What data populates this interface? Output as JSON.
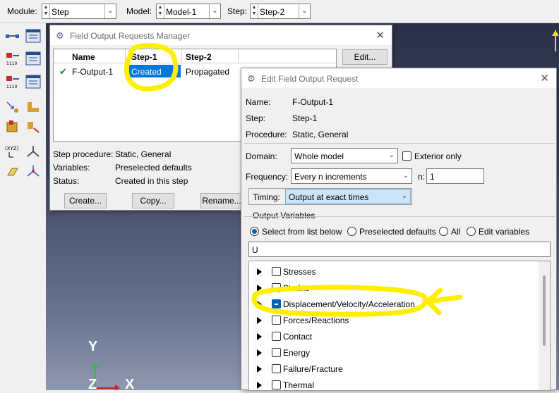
{
  "toolbar": {
    "module_label": "Module:",
    "module_value": "Step",
    "model_label": "Model:",
    "model_value": "Model-1",
    "step_label": "Step:",
    "step_value": "Step-2"
  },
  "canvas": {
    "axis_y": "Y",
    "axis_z": "Z",
    "axis_x": "X"
  },
  "manager": {
    "title": "Field Output Requests Manager",
    "columns": [
      "Name",
      "Step-1",
      "Step-2"
    ],
    "row": {
      "check": "✔",
      "name": "F-Output-1",
      "step1": "Created",
      "step2": "Propagated"
    },
    "edit_button": "Edit...",
    "info": [
      {
        "label": "Step procedure:",
        "value": "Static, General"
      },
      {
        "label": "Variables:",
        "value": "Preselected defaults"
      },
      {
        "label": "Status:",
        "value": "Created in this step"
      }
    ],
    "buttons": {
      "create": "Create...",
      "copy": "Copy...",
      "rename": "Rename..."
    }
  },
  "editor": {
    "title": "Edit Field Output Request",
    "name_label": "Name:",
    "name_value": "F-Output-1",
    "step_label": "Step:",
    "step_value": "Step-1",
    "procedure_label": "Procedure:",
    "procedure_value": "Static, General",
    "domain_label": "Domain:",
    "domain_value": "Whole model",
    "exterior_label": "Exterior only",
    "frequency_label": "Frequency:",
    "frequency_value": "Every n increments",
    "n_label": "n:",
    "n_value": "1",
    "timing_label": "Timing:",
    "timing_value": "Output at exact times",
    "output_vars_label": "Output Variables",
    "radio_options": [
      "Select from list below",
      "Preselected defaults",
      "All",
      "Edit variables"
    ],
    "filter_value": "U",
    "variables": [
      "Stresses",
      "Strains",
      "Displacement/Velocity/Acceleration",
      "Forces/Reactions",
      "Contact",
      "Energy",
      "Failure/Fracture",
      "Thermal"
    ]
  },
  "colors": {
    "highlight": "#0078d7",
    "annotation": "#ffee00",
    "check": "#1a8a1a"
  }
}
